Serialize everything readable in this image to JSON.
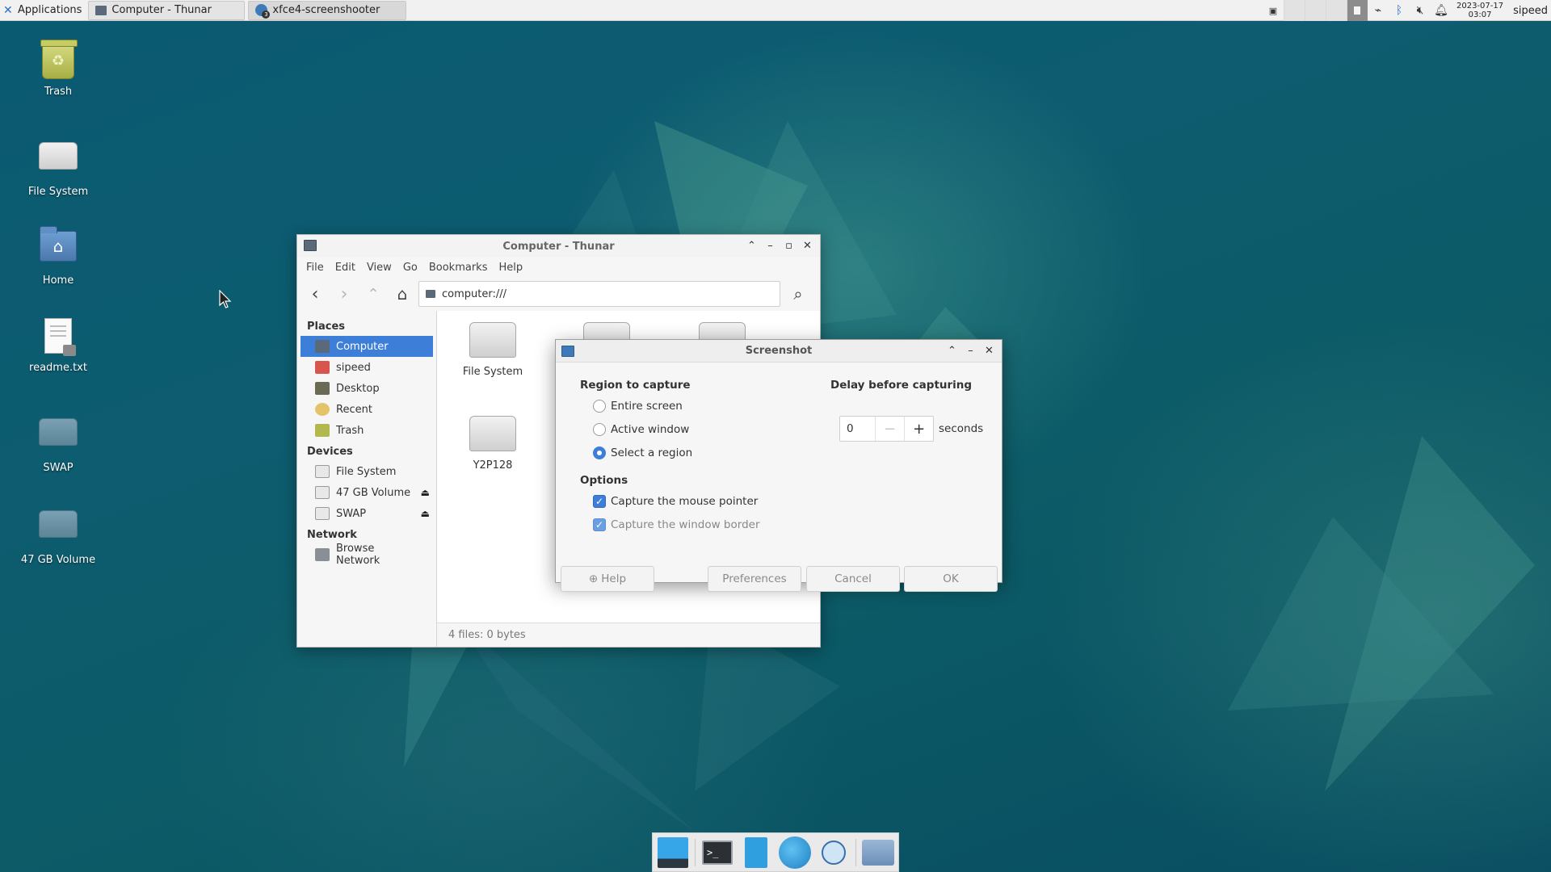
{
  "top_panel": {
    "applications_label": "Applications",
    "tasks": [
      {
        "label": "Computer - Thunar",
        "icon": "computer-icon"
      },
      {
        "label": "xfce4-screenshooter",
        "icon": "screenshooter-icon",
        "badge": "3"
      }
    ],
    "clock_date": "2023-07-17",
    "clock_time": "03:07",
    "user": "sipeed"
  },
  "desktop_icons": [
    {
      "label": "Trash"
    },
    {
      "label": "File System"
    },
    {
      "label": "Home"
    },
    {
      "label": "readme.txt"
    },
    {
      "label": "SWAP"
    },
    {
      "label": "47 GB Volume"
    }
  ],
  "thunar": {
    "title": "Computer - Thunar",
    "menu": [
      "File",
      "Edit",
      "View",
      "Go",
      "Bookmarks",
      "Help"
    ],
    "location": "computer:///",
    "sidebar": {
      "places_header": "Places",
      "places": [
        "Computer",
        "sipeed",
        "Desktop",
        "Recent",
        "Trash"
      ],
      "devices_header": "Devices",
      "devices": [
        "File System",
        "47 GB Volume",
        "SWAP"
      ],
      "network_header": "Network",
      "network": [
        "Browse Network"
      ]
    },
    "files": [
      "File System",
      "Y2P128"
    ],
    "status": "4 files: 0 bytes"
  },
  "screenshot_dialog": {
    "title": "Screenshot",
    "region_label": "Region to capture",
    "regions": [
      "Entire screen",
      "Active window",
      "Select a region"
    ],
    "selected_region": "Select a region",
    "delay_label": "Delay before capturing",
    "delay_value": "0",
    "delay_unit": "seconds",
    "options_label": "Options",
    "options": [
      "Capture the mouse pointer",
      "Capture the window border"
    ],
    "buttons": {
      "help": "Help",
      "preferences": "Preferences",
      "cancel": "Cancel",
      "ok": "OK"
    }
  },
  "colors": {
    "selection": "#3d7ed9",
    "desktop_bg": "#0c5b6c"
  }
}
